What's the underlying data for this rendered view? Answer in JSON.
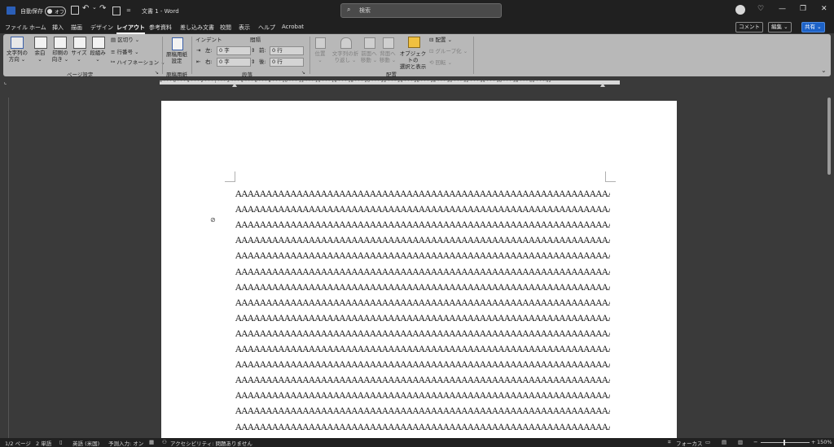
{
  "titlebar": {
    "autosave_label": "自動保存",
    "autosave_state": "オフ",
    "undo_chev": "⌄",
    "qat_more": "=",
    "doc_title": "文書 1 - Word",
    "search_placeholder": "検索",
    "minimize": "—",
    "restore": "❐",
    "close": "✕"
  },
  "menu": {
    "tabs": [
      "ファイル",
      "ホーム",
      "挿入",
      "描画",
      "デザイン",
      "レイアウト",
      "参考資料",
      "差し込み文書",
      "校閲",
      "表示",
      "ヘルプ",
      "Acrobat"
    ],
    "comment": "コメント",
    "edit": "編集 ⌄",
    "share": "共有 ⌄"
  },
  "ribbon": {
    "text_direction": [
      "文字列の",
      "方向 ⌄"
    ],
    "margins": [
      "余白",
      "⌄"
    ],
    "orientation": [
      "印刷の",
      "向き ⌄"
    ],
    "size": [
      "サイズ",
      "⌄"
    ],
    "columns": [
      "段組み",
      "⌄"
    ],
    "breaks": "区切り ⌄",
    "line_numbers": "行番号 ⌄",
    "hyphenation": "ハイフネーション ⌄",
    "page_setup_label": "ページ設定",
    "manuscript": [
      "原稿用紙",
      "設定"
    ],
    "manuscript_label": "原稿用紙",
    "indent_title": "インデント",
    "indent_left_label": "左:",
    "indent_left": "0 字",
    "indent_right_label": "右:",
    "indent_right": "0 字",
    "spacing_title": "間隔",
    "spacing_before_label": "前:",
    "spacing_before": "0 行",
    "spacing_after_label": "後:",
    "spacing_after": "0 行",
    "paragraph_label": "段落",
    "position": [
      "位置",
      "⌄"
    ],
    "wrap_text": [
      "文字列の折",
      "り返し ⌄"
    ],
    "bring_forward": [
      "前面へ",
      "移動 ⌄"
    ],
    "send_backward": [
      "背面へ",
      "移動 ⌄"
    ],
    "selection_pane": [
      "オブジェクトの",
      "選択と表示"
    ],
    "align": "配置 ⌄",
    "group": "グループ化 ⌄",
    "rotate": "回転 ⌄",
    "arrange_label": "配置"
  },
  "ruler": {
    "ticks": "8 · · · 6 · · · 4 · · · 2 · · · | · · · 2 · · · 4 · · · 6 · · · 8 · · · 10 · · · 12 · · · 14 · · · 16 · · · 18 · · · 20 · · · 22 · · · 24 · · · 26 · · · 28 · · · 30 · · · 32 · · · 34 · · · 36 · · · 38 · · · 40 · · · 42"
  },
  "document": {
    "line_text": "AAAAAAAAAAAAAAAAAAAAAAAAAAAAAAAAAAAAAAAAAAAAAAAAAAAAAAAAAAAAAAAAAAAA",
    "line_count": 16
  },
  "status": {
    "page": "1/2 ページ",
    "words": "2 単語",
    "language": "英語 (米国)",
    "predict": "予測入力: オン",
    "accessibility": "アクセシビリティ: 問題ありません",
    "focus": "フォーカス",
    "zoom": "150%"
  }
}
